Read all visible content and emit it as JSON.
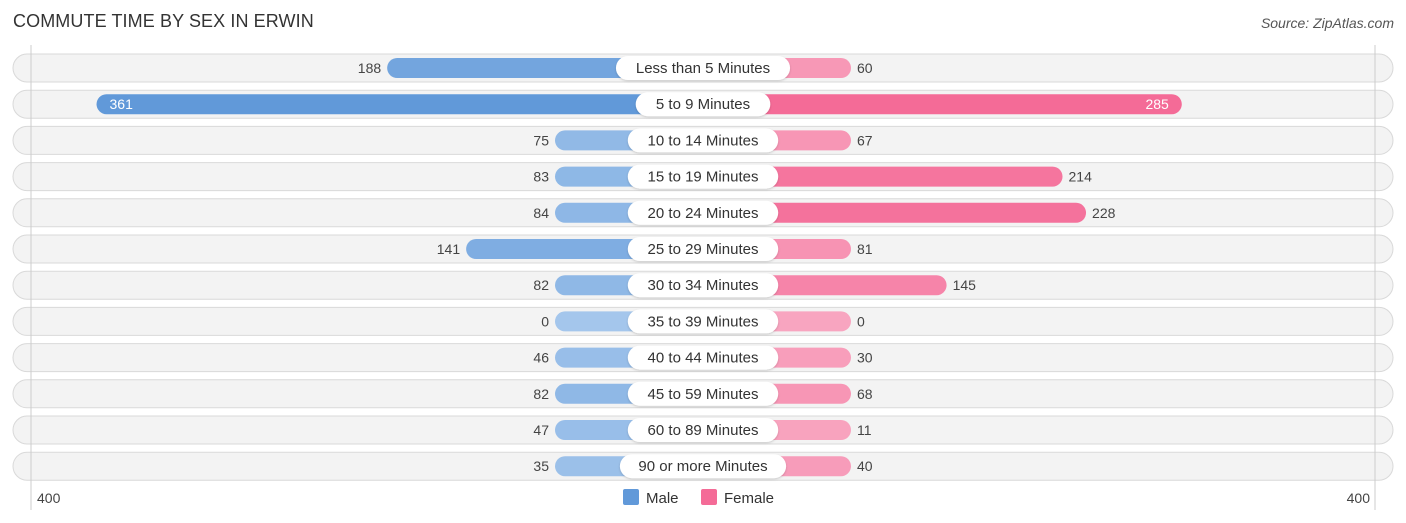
{
  "header": {
    "title": "COMMUTE TIME BY SEX IN ERWIN",
    "source": "Source: ZipAtlas.com"
  },
  "chart_data": {
    "type": "bar",
    "orientation": "horizontal-diverging",
    "title": "COMMUTE TIME BY SEX IN ERWIN",
    "categories": [
      "Less than 5 Minutes",
      "5 to 9 Minutes",
      "10 to 14 Minutes",
      "15 to 19 Minutes",
      "20 to 24 Minutes",
      "25 to 29 Minutes",
      "30 to 34 Minutes",
      "35 to 39 Minutes",
      "40 to 44 Minutes",
      "45 to 59 Minutes",
      "60 to 89 Minutes",
      "90 or more Minutes"
    ],
    "series": [
      {
        "name": "Male",
        "side": "left",
        "color": "#6199d9",
        "light_color": "#a4c6ec",
        "values": [
          188,
          361,
          75,
          83,
          84,
          141,
          82,
          0,
          46,
          82,
          47,
          35
        ]
      },
      {
        "name": "Female",
        "side": "right",
        "color": "#f46b97",
        "light_color": "#f8a5c0",
        "values": [
          60,
          285,
          67,
          214,
          228,
          81,
          145,
          0,
          30,
          68,
          11,
          40
        ]
      }
    ],
    "axis": {
      "left_label": "400",
      "right_label": "400",
      "max": 400
    },
    "legend": {
      "position": "bottom-center",
      "entries": [
        "Male",
        "Female"
      ]
    },
    "grid": false
  }
}
